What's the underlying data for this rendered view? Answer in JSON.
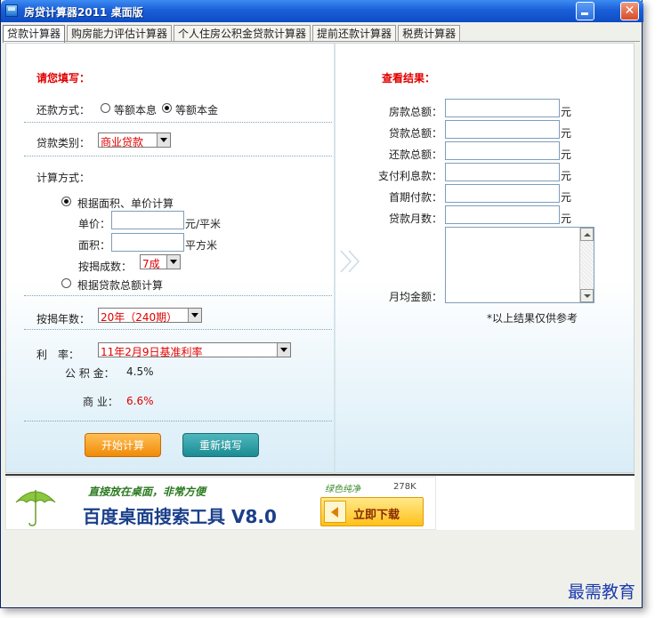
{
  "window": {
    "title": "房贷计算器2011 桌面版"
  },
  "tabs": [
    {
      "label": "贷款计算器"
    },
    {
      "label": "购房能力评估计算器"
    },
    {
      "label": "个人住房公积金贷款计算器"
    },
    {
      "label": "提前还款计算器"
    },
    {
      "label": "税费计算器"
    }
  ],
  "form": {
    "heading": "请您填写：",
    "repay_label": "还款方式：",
    "repay_opt1": "等额本息",
    "repay_opt2": "等额本金",
    "loan_type_label": "贷款类别：",
    "loan_type_value": "商业贷款",
    "calc_method_label": "计算方式：",
    "method_area": "根据面积、单价计算",
    "unit_price_label": "单价：",
    "unit_price_unit": "元/平米",
    "area_label": "面积：",
    "area_unit": "平方米",
    "ratio_label": "按揭成数：",
    "ratio_value": "7成",
    "method_total": "根据贷款总额计算",
    "years_label": "按揭年数：",
    "years_value": "20年（240期）",
    "rate_label": "利　率：",
    "rate_value": "11年2月9日基准利率",
    "fund_label": "公 积 金：",
    "fund_value": "4.5%",
    "biz_label": "商 业：",
    "biz_value": "6.6%",
    "calc_button": "开始计算",
    "reset_button": "重新填写"
  },
  "result": {
    "heading": "查看结果：",
    "house_total": "房款总额：",
    "loan_total": "贷款总额：",
    "repay_total": "还款总额：",
    "interest": "支付利息款：",
    "down_payment": "首期付款：",
    "months": "贷款月数：",
    "monthly": "月均金额：",
    "unit": "元",
    "note": "*以上结果仅供参考"
  },
  "ad": {
    "slogan": "直接放在桌面，非常方便",
    "title": "百度桌面搜索工具 V8.0",
    "green": "绿色纯净",
    "size": "278K",
    "download": "立即下载"
  },
  "watermark": "最需教育",
  "colors": {
    "accent_red": "#e00000",
    "title_blue": "#1a5fd8",
    "orange_button": "#f08a08",
    "teal_button": "#1b8b92"
  }
}
